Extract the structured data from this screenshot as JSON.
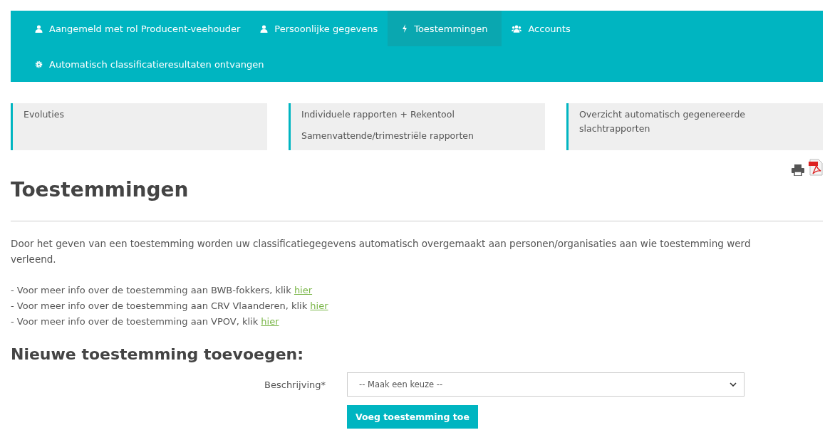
{
  "nav": {
    "items": [
      {
        "label": "Aangemeld met rol Producent-veehouder",
        "selected": false
      },
      {
        "label": "Persoonlijke gegevens",
        "selected": false
      },
      {
        "label": "Toestemmingen",
        "selected": true
      },
      {
        "label": "Accounts",
        "selected": false
      },
      {
        "label": "Automatisch classificatieresultaten ontvangen",
        "selected": false
      }
    ]
  },
  "cards": [
    {
      "links": [
        "Evoluties"
      ]
    },
    {
      "links": [
        "Individuele rapporten + Rekentool",
        "Samenvattende/trimestriële rapporten"
      ]
    },
    {
      "links": [
        "Overzicht automatisch gegenereerde slachtrapporten"
      ]
    }
  ],
  "title": "Toestemmingen",
  "intro": "Door het geven van een toestemming worden uw classificatiegegevens automatisch overgemaakt aan personen/organisaties aan wie toestemming werd verleend.",
  "info_lines": [
    {
      "text": "- Voor meer info over de toestemming aan BWB-fokkers, klik ",
      "link": "hier"
    },
    {
      "text": "- Voor meer info over de toestemming aan CRV Vlaanderen, klik ",
      "link": "hier"
    },
    {
      "text": "- Voor meer info over de toestemming aan VPOV, klik ",
      "link": "hier"
    }
  ],
  "form": {
    "heading": "Nieuwe toestemming toevoegen:",
    "label": "Beschrijving*",
    "select_value": "-- Maak een keuze --",
    "button": "Voeg toestemming toe"
  }
}
